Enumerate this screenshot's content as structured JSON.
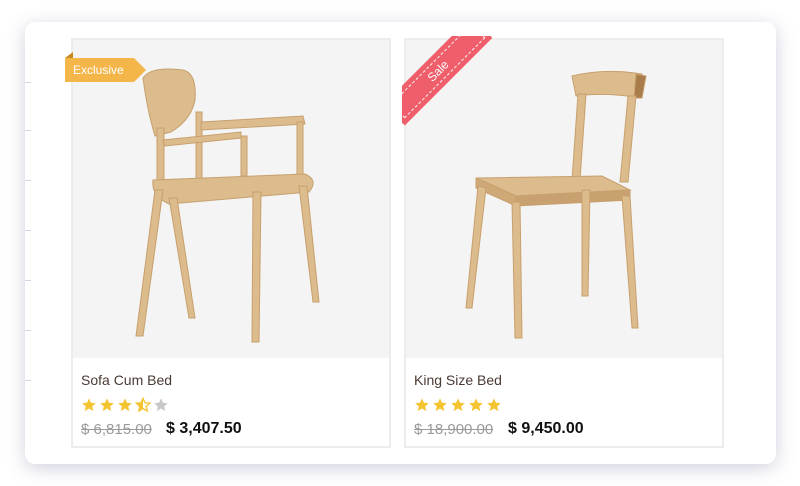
{
  "products": [
    {
      "badge": "Exclusive",
      "name": "Sofa Cum Bed",
      "rating": 3.5,
      "old_price": "$ 6,815.00",
      "price": "$ 3,407.50"
    },
    {
      "badge": "Sale",
      "name": "King Size Bed",
      "rating": 5,
      "old_price": "$ 18,900.00",
      "price": "$ 9,450.00"
    }
  ],
  "colors": {
    "star": "#f4c430",
    "star_empty": "#c8c8c8",
    "exclusive": "#f5b649",
    "sale": "#ee5f6b",
    "wood": "#dcbb8c"
  }
}
